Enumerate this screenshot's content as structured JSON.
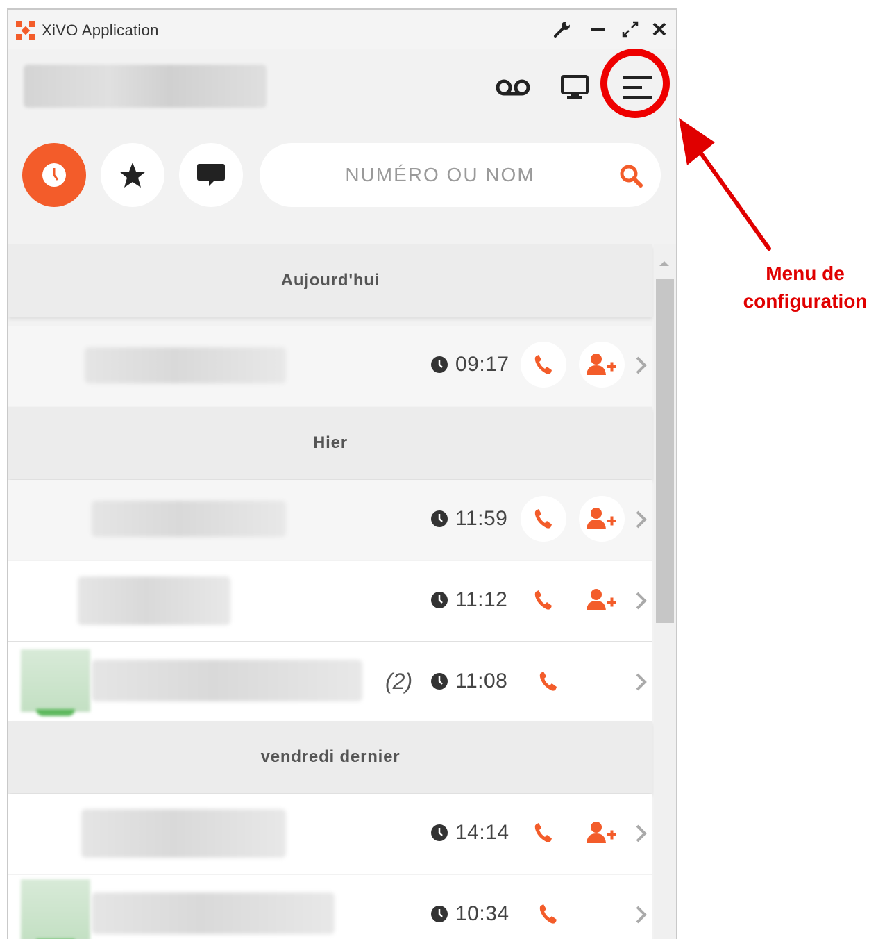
{
  "window": {
    "title": "XiVO Application"
  },
  "search": {
    "placeholder": "NUMÉRO OU NOM"
  },
  "groups": [
    {
      "label": "Aujourd'hui"
    },
    {
      "label": "Hier"
    },
    {
      "label": "vendredi dernier"
    }
  ],
  "calls": [
    {
      "time": "09:17"
    },
    {
      "time": "11:59"
    },
    {
      "time": "11:12"
    },
    {
      "time": "11:08",
      "count": "(2)"
    },
    {
      "time": "14:14"
    },
    {
      "time": "10:34"
    }
  ],
  "annotation": {
    "line1": "Menu de",
    "line2": "configuration"
  },
  "colors": {
    "accent": "#f35c2a",
    "annotation": "#e00000",
    "presence": "#5cb85c"
  }
}
